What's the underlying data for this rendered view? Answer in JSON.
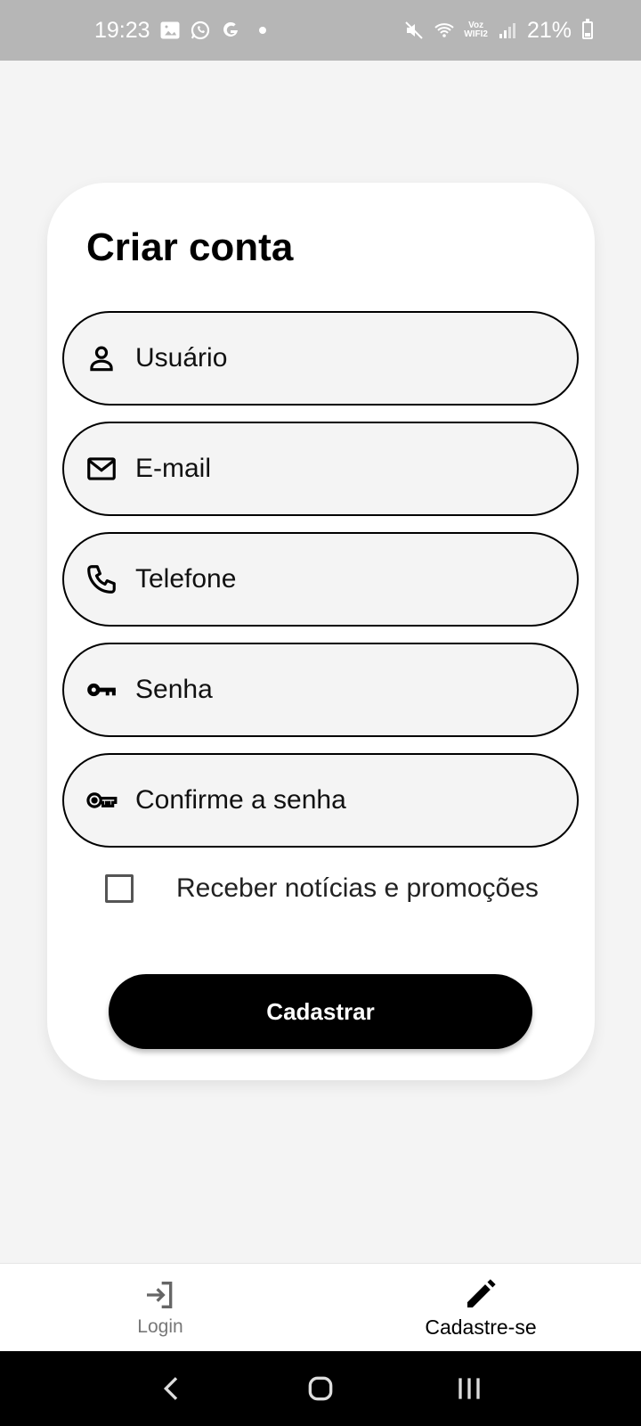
{
  "status_bar": {
    "time": "19:23",
    "voz_line1": "Voz",
    "voz_line2": "WIFI2",
    "battery": "21%"
  },
  "form": {
    "title": "Criar conta",
    "fields": [
      {
        "placeholder": "Usuário",
        "icon": "person-icon"
      },
      {
        "placeholder": "E-mail",
        "icon": "mail-icon"
      },
      {
        "placeholder": "Telefone",
        "icon": "phone-icon"
      },
      {
        "placeholder": "Senha",
        "icon": "key-icon"
      },
      {
        "placeholder": "Confirme a senha",
        "icon": "key-outline-icon"
      }
    ],
    "checkbox_label": "Receber notícias e promoções",
    "checkbox_checked": false,
    "submit_label": "Cadastrar"
  },
  "bottom_nav": {
    "items": [
      {
        "label": "Login",
        "icon": "login-icon",
        "active": false
      },
      {
        "label": "Cadastre-se",
        "icon": "pencil-icon",
        "active": true
      }
    ]
  }
}
